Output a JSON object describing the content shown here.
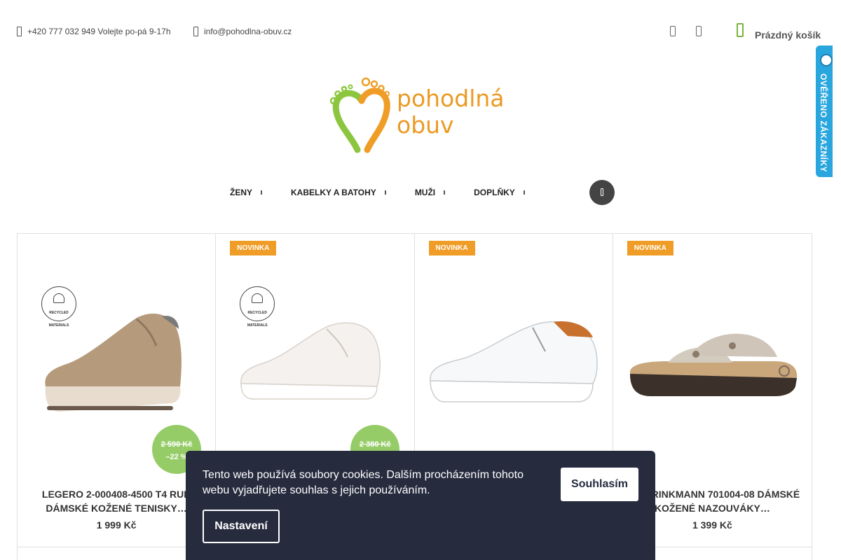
{
  "topbar": {
    "phone": "+420 777 032 949 Volejte po-pá 9-17h",
    "email": "info@pohodlna-obuv.cz",
    "cart_label": "Prázdný košík",
    "verified_badge": "OVĚŘENO ZÁKAZNÍKY"
  },
  "logo": {
    "line1": "pohodlná",
    "line2": "obuv"
  },
  "nav": {
    "items": [
      {
        "label": "ŽENY"
      },
      {
        "label": "KABELKY A BATOHY"
      },
      {
        "label": "MUŽI"
      },
      {
        "label": "DOPLŇKY"
      }
    ]
  },
  "products": [
    {
      "badge": "",
      "eco_text": "RECYCLED MATERIALS",
      "old_price": "2 590 Kč",
      "discount": "–22 %",
      "name": "LEGERO 2-000408-4500 T4 RUN DÁMSKÉ KOŽENÉ TENISKY…",
      "price": "1 999 Kč"
    },
    {
      "badge": "NOVINKA",
      "eco_text": "RECYCLED MATERIALS",
      "old_price": "2 380 Kč",
      "discount": "",
      "name": "",
      "price": ""
    },
    {
      "badge": "NOVINKA",
      "eco_text": "",
      "old_price": "",
      "discount": "",
      "name": "",
      "price": ""
    },
    {
      "badge": "NOVINKA",
      "eco_text": "",
      "old_price": "",
      "discount": "",
      "name": "DR. BRINKMANN 701004-08 DÁMSKÉ KOŽENÉ NAZOUVÁKY…",
      "price": "1 399 Kč"
    }
  ],
  "cookie": {
    "text": "Tento web používá soubory cookies. Dalším procházením tohoto webu vyjadřujete souhlas s jejich používáním.",
    "accept": "Souhlasím",
    "settings": "Nastavení"
  },
  "colors": {
    "brand_orange": "#ef9d27",
    "brand_green": "#7bb43c",
    "discount_green": "#96cc68",
    "cookie_bg": "#262b3e",
    "verified_blue": "#2aa6de"
  }
}
